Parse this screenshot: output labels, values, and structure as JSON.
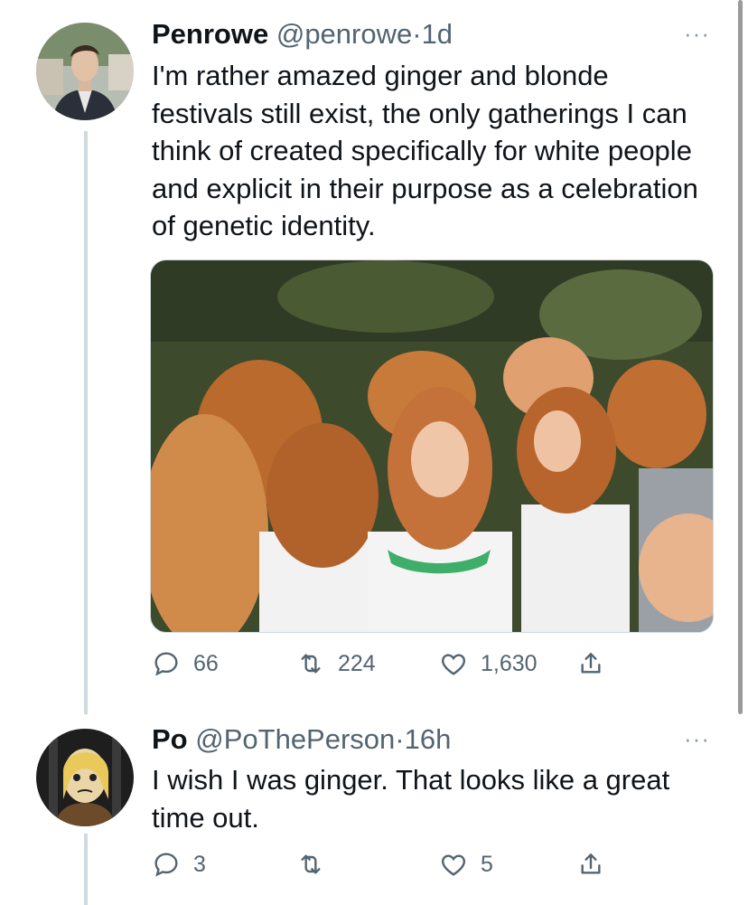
{
  "tweets": [
    {
      "name": "Penrowe",
      "handle": "@penrowe",
      "separator": "·",
      "time": "1d",
      "more": "···",
      "text": "I'm rather amazed ginger and blonde festivals still exist, the only gatherings I can think of created specifically for white people and explicit in their purpose as a celebration of genetic identity.",
      "actions": {
        "replies": "66",
        "retweets": "224",
        "likes": "1,630"
      }
    },
    {
      "name": "Po",
      "handle": "@PoThePerson",
      "separator": "·",
      "time": "16h",
      "more": "···",
      "text": "I wish I was ginger. That looks like a great time out.",
      "actions": {
        "replies": "3",
        "retweets": "",
        "likes": "5"
      }
    }
  ],
  "icons": [
    "reply-icon",
    "retweet-icon",
    "like-icon",
    "share-icon",
    "more-icon"
  ]
}
